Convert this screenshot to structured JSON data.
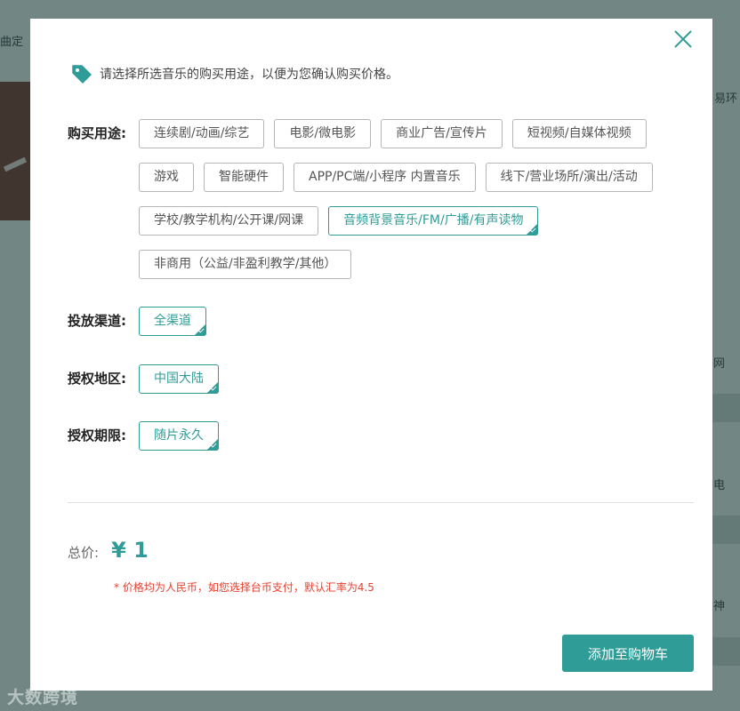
{
  "background": {
    "fragments": [
      "曲定",
      "易环",
      "网",
      "电",
      "神"
    ],
    "watermark": "大数跨境"
  },
  "modal": {
    "notice": "请选择所选音乐的购买用途，以便为您确认购买价格。",
    "usage": {
      "label": "购买用途:",
      "options": [
        {
          "label": "连续剧/动画/综艺",
          "selected": false
        },
        {
          "label": "电影/微电影",
          "selected": false
        },
        {
          "label": "商业广告/宣传片",
          "selected": false
        },
        {
          "label": "短视频/自媒体视频",
          "selected": false
        },
        {
          "label": "游戏",
          "selected": false
        },
        {
          "label": "智能硬件",
          "selected": false
        },
        {
          "label": "APP/PC端/小程序 内置音乐",
          "selected": false
        },
        {
          "label": "线下/营业场所/演出/活动",
          "selected": false
        },
        {
          "label": "学校/教学机构/公开课/网课",
          "selected": false
        },
        {
          "label": "音频背景音乐/FM/广播/有声读物",
          "selected": true
        },
        {
          "label": "非商用（公益/非盈利教学/其他）",
          "selected": false
        }
      ]
    },
    "channel": {
      "label": "投放渠道:",
      "options": [
        {
          "label": "全渠道",
          "selected": true
        }
      ]
    },
    "region": {
      "label": "授权地区:",
      "options": [
        {
          "label": "中国大陆",
          "selected": true
        }
      ]
    },
    "period": {
      "label": "授权期限:",
      "options": [
        {
          "label": "随片永久",
          "selected": true
        }
      ]
    },
    "total": {
      "label": "总价:",
      "price": "¥ 1"
    },
    "note": "* 价格均为人民币，如您选择台币支付，默认汇率为4.5",
    "cart_button": "添加至购物车",
    "colors": {
      "accent": "#2f9c98",
      "note": "#e8402f"
    }
  }
}
